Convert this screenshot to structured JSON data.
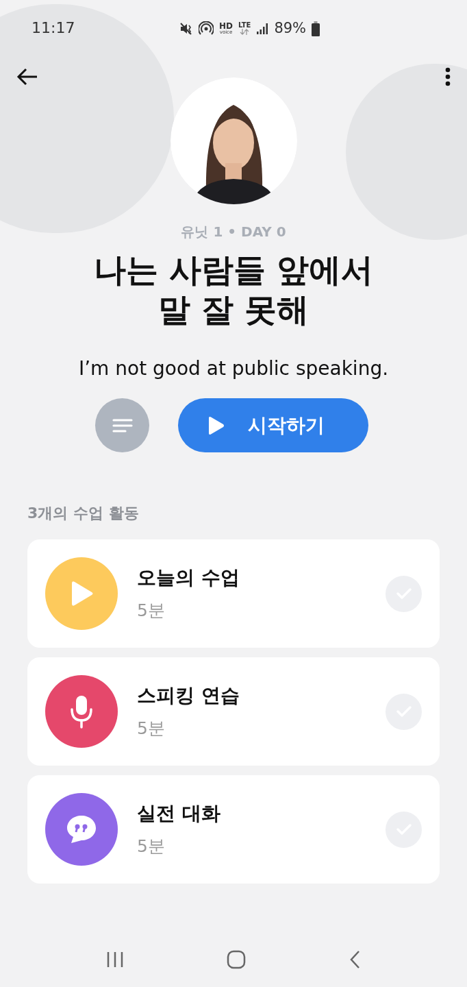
{
  "status_bar": {
    "time": "11:17",
    "hd": "HD",
    "voice": "voice",
    "lte": "LTE",
    "battery": "89%"
  },
  "lesson": {
    "unit": "유닛 1 • DAY 0",
    "title_lines": [
      "나는 사람들 앞에서",
      "말 잘 못해"
    ],
    "translation": "I’m not good at public speaking.",
    "start_button": "시작하기"
  },
  "section_title": "3개의 수업 활동",
  "activities": [
    {
      "kind": "play",
      "color": "#fdca5c",
      "title": "오늘의 수업",
      "duration": "5분",
      "checked": false
    },
    {
      "kind": "mic",
      "color": "#e5486b",
      "title": "스피킹 연습",
      "duration": "5분",
      "checked": false
    },
    {
      "kind": "chat",
      "color": "#8f68e8",
      "title": "실전 대화",
      "duration": "5분",
      "checked": false
    }
  ]
}
